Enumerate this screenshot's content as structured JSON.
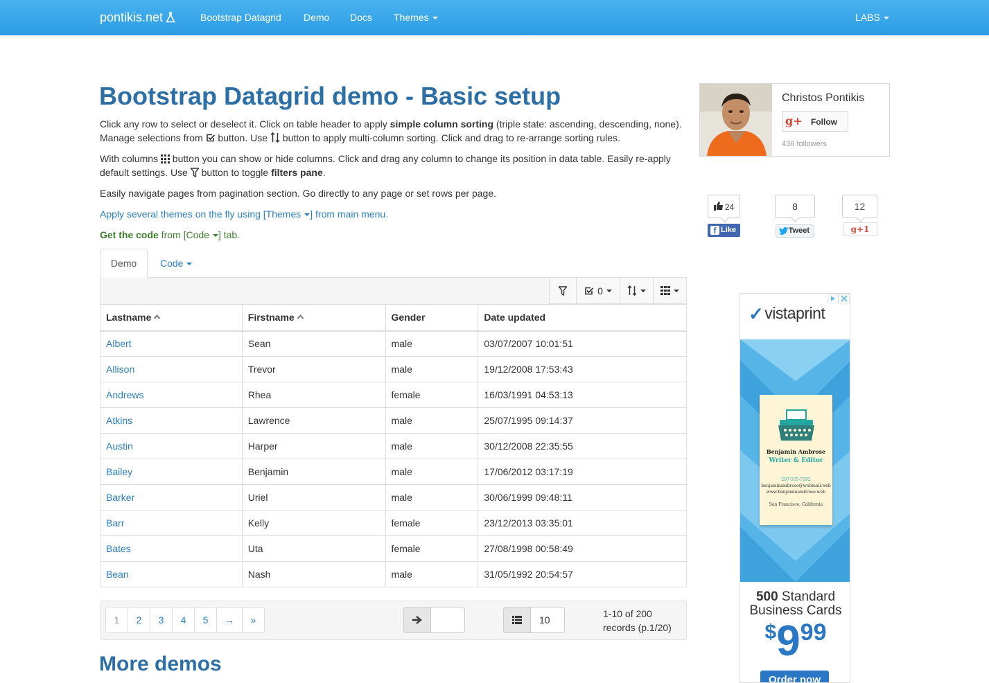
{
  "navbar": {
    "brand": "pontikis.net",
    "links": [
      "Bootstrap Datagrid",
      "Demo",
      "Docs"
    ],
    "themes_label": "Themes",
    "labs_label": "LABS"
  },
  "page": {
    "title": "Bootstrap Datagrid demo - Basic setup",
    "p1_a": "Click any row to select or deselect it. Click on table header to apply ",
    "p1_b": "simple column sorting",
    "p1_c": " (triple state: ascending, descending, none). Manage selections from ",
    "p1_d": " button. Use ",
    "p1_e": " button to apply multi-column sorting. Click and drag to re-arrange sorting rules.",
    "p2_a": "With columns ",
    "p2_b": " button you can show or hide columns. Click and drag any column to change its position in data table. Easily re-apply default settings. Use ",
    "p2_c": " button to toggle ",
    "p2_d": "filters pane",
    "p2_e": ".",
    "p3": "Easily navigate pages from pagination section. Go directly to any page or set rows per page.",
    "p4": "Apply several themes on the fly using [Themes",
    "p4_end": "] from main menu.",
    "p5_bold": "Get the code",
    "p5_a": " from [Code",
    "p5_b": "] tab.",
    "more_demos": "More demos"
  },
  "tabs": [
    {
      "label": "Demo",
      "active": true
    },
    {
      "label": "Code",
      "active": false
    }
  ],
  "toolbar": {
    "selection_count": "0"
  },
  "table": {
    "columns": [
      "Lastname",
      "Firstname",
      "Gender",
      "Date updated"
    ],
    "rows": [
      [
        "Albert",
        "Sean",
        "male",
        "03/07/2007 10:01:51"
      ],
      [
        "Allison",
        "Trevor",
        "male",
        "19/12/2008 17:53:43"
      ],
      [
        "Andrews",
        "Rhea",
        "female",
        "16/03/1991 04:53:13"
      ],
      [
        "Atkins",
        "Lawrence",
        "male",
        "25/07/1995 09:14:37"
      ],
      [
        "Austin",
        "Harper",
        "male",
        "30/12/2008 22:35:55"
      ],
      [
        "Bailey",
        "Benjamin",
        "male",
        "17/06/2012 03:17:19"
      ],
      [
        "Barker",
        "Uriel",
        "male",
        "30/06/1999 09:48:11"
      ],
      [
        "Barr",
        "Kelly",
        "female",
        "23/12/2013 03:35:01"
      ],
      [
        "Bates",
        "Uta",
        "female",
        "27/08/1998 00:58:49"
      ],
      [
        "Bean",
        "Nash",
        "male",
        "31/05/1992 20:54:57"
      ]
    ]
  },
  "pager": {
    "pages": [
      "1",
      "2",
      "3",
      "4",
      "5",
      "→",
      "»"
    ],
    "goto_value": "",
    "rows_per_page": "10",
    "records_line1": "1-10 of 200",
    "records_line2": "records (p.1/20)"
  },
  "sidebar": {
    "gplus_name": "Christos Pontikis",
    "gplus_follow": "Follow",
    "gplus_followers": "436 followers",
    "fb_count": "24",
    "fb_label": "Like",
    "tweet_count": "8",
    "tweet_label": "Tweet",
    "gplus_count": "12",
    "gplus_one": "g+1"
  },
  "ad": {
    "brand": "vistaprint",
    "card_name": "Benjamin Ambrose",
    "card_role": "Writer & Editor",
    "card_phone": "207-555-7192",
    "card_email": "benjaminambrose@webmail.web",
    "card_web": "www.benjaminambrose.web",
    "card_city": "San Francisco, California",
    "offer_count": "500",
    "offer_line1": " Standard",
    "offer_line2": "Business Cards",
    "price_dollar": "$",
    "price_main": "9",
    "price_cents": "99",
    "cta": "Order now"
  },
  "colors": {
    "navbar": "#2c9ce4",
    "title": "#2b6fa6",
    "link": "#2a7fc4",
    "code_green": "#3c7f2e"
  }
}
